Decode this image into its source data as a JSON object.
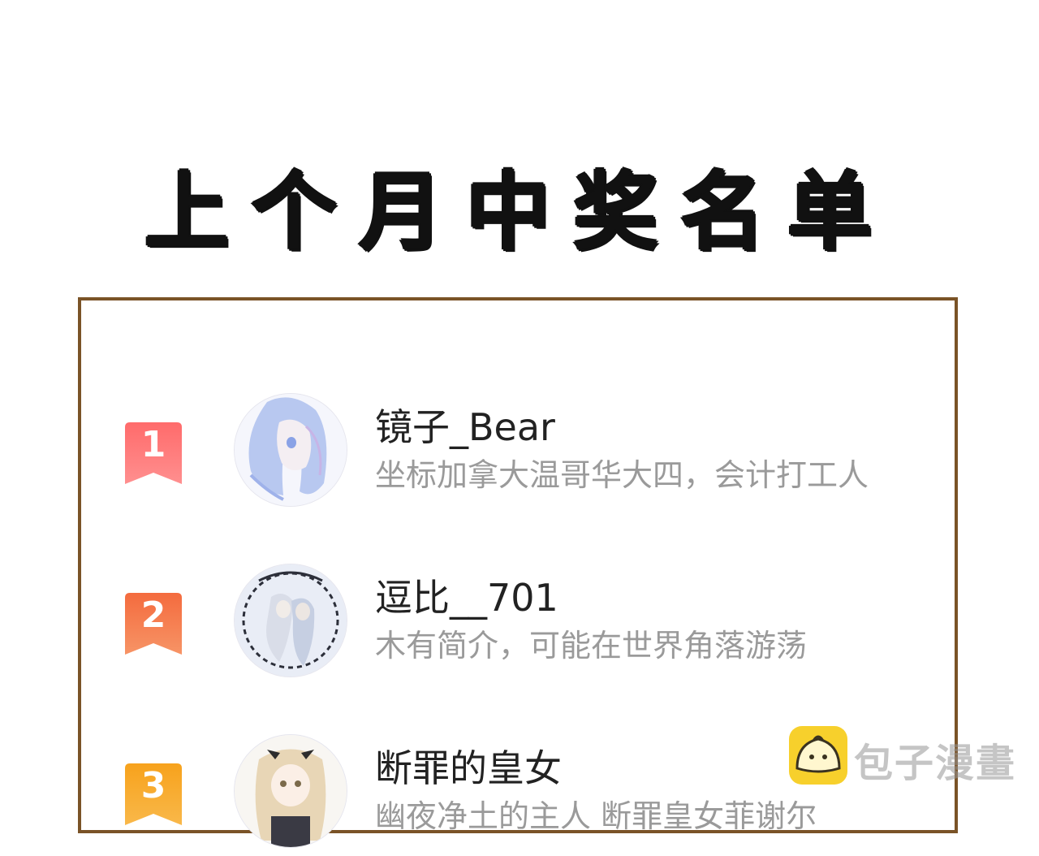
{
  "title": "上个月中奖名单",
  "colors": {
    "frame_border": "#7a5327",
    "rank1": "#f25c5c",
    "rank2": "#f27a4a",
    "rank3": "#f59a1c",
    "bio_text": "#9a9a9a"
  },
  "winners": [
    {
      "rank": "1",
      "name": "镜子_Bear",
      "bio": "坐标加拿大温哥华大四，会计打工人",
      "avatar": "anime-avatar-blue-hair"
    },
    {
      "rank": "2",
      "name": "逗比__701",
      "bio": "木有简介，可能在世界角落游荡",
      "avatar": "anime-avatar-couple"
    },
    {
      "rank": "3",
      "name": "断罪的皇女",
      "bio": "幽夜净土的主人 断罪皇女菲谢尔",
      "avatar": "anime-avatar-blonde-girl"
    }
  ],
  "watermark": {
    "text": "包子漫畫",
    "icon": "bun-logo-icon"
  }
}
